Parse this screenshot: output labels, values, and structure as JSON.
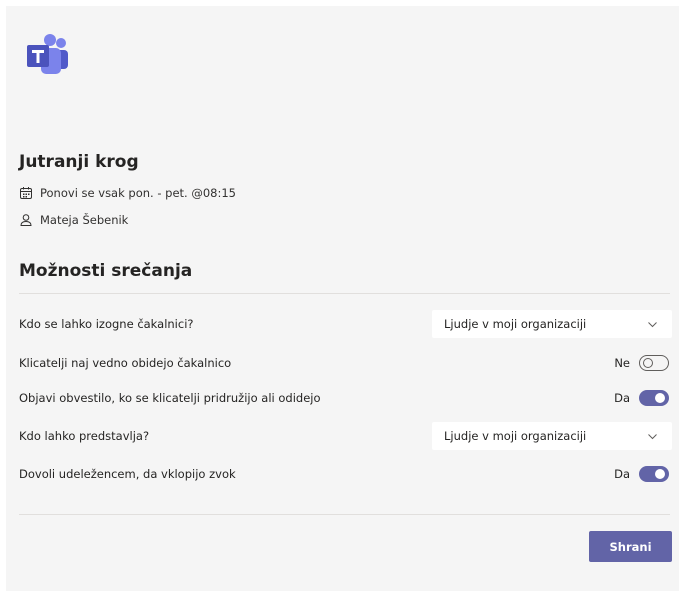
{
  "app": {
    "logo_icon": "microsoft-teams-logo"
  },
  "meeting": {
    "title": "Jutranji krog",
    "schedule": "Ponovi se vsak pon. - pet. @08:15",
    "schedule_icon": "calendar-icon",
    "organizer": "Mateja Šebenik",
    "organizer_icon": "person-icon"
  },
  "options": {
    "heading": "Možnosti srečanja",
    "bypass_lobby": {
      "label": "Kdo se lahko izogne čakalnici?",
      "value": "Ljudje v moji organizaciji"
    },
    "callers_lobby": {
      "label": "Klicatelji naj vedno obidejo čakalnico",
      "state_text": "Ne",
      "on": false
    },
    "announce": {
      "label": "Objavi obvestilo, ko se klicatelji pridružijo ali odidejo",
      "state_text": "Da",
      "on": true
    },
    "presenters": {
      "label": "Kdo lahko predstavlja?",
      "value": "Ljudje v moji organizaciji"
    },
    "unmute": {
      "label": "Dovoli udeležencem, da vklopijo zvok",
      "state_text": "Da",
      "on": true
    }
  },
  "actions": {
    "save_label": "Shrani"
  },
  "colors": {
    "accent": "#6264a7",
    "panel_bg": "#f5f5f5",
    "text": "#252423"
  }
}
